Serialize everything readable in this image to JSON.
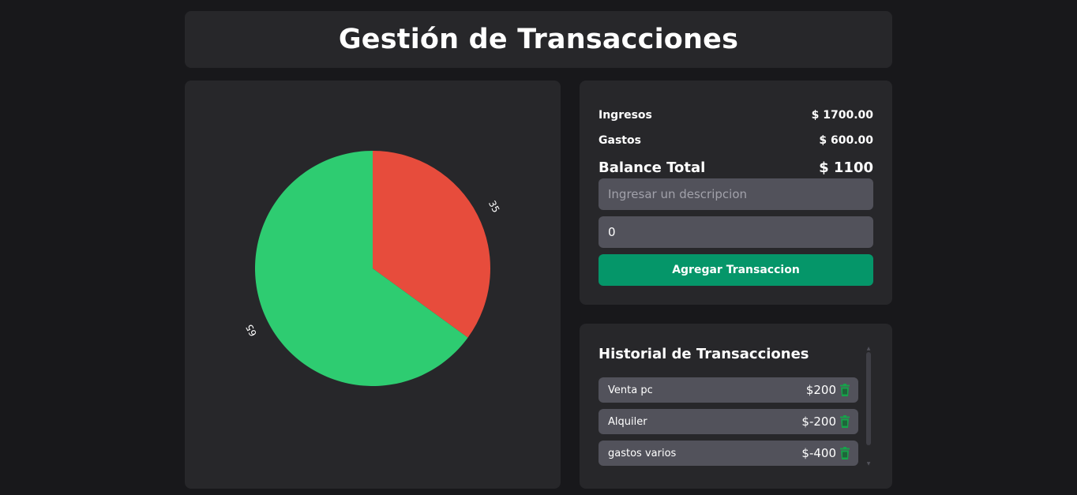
{
  "header": {
    "title": "Gestión de Transacciones"
  },
  "summary": {
    "income_label": "Ingresos",
    "income_value": "$ 1700.00",
    "expense_label": "Gastos",
    "expense_value": "$ 600.00",
    "balance_label": "Balance Total",
    "balance_value": "$ 1100"
  },
  "form": {
    "description_placeholder": "Ingresar un descripcion",
    "amount_value": "0",
    "submit_label": "Agregar Transaccion"
  },
  "history": {
    "title": "Historial de Transacciones",
    "items": [
      {
        "description": "Venta pc",
        "amount": "$200"
      },
      {
        "description": "Alquiler",
        "amount": "$-200"
      },
      {
        "description": "gastos varios",
        "amount": "$-400"
      }
    ]
  },
  "colors": {
    "background": "#18181b",
    "panel": "#27272a",
    "input": "#52525b",
    "accent": "#059669",
    "trash_icon": "#16a34a"
  },
  "chart_data": {
    "type": "pie",
    "slices": [
      {
        "value": 65,
        "label": "65",
        "color": "#2ecc71"
      },
      {
        "value": 35,
        "label": "35",
        "color": "#e74c3c"
      }
    ]
  }
}
